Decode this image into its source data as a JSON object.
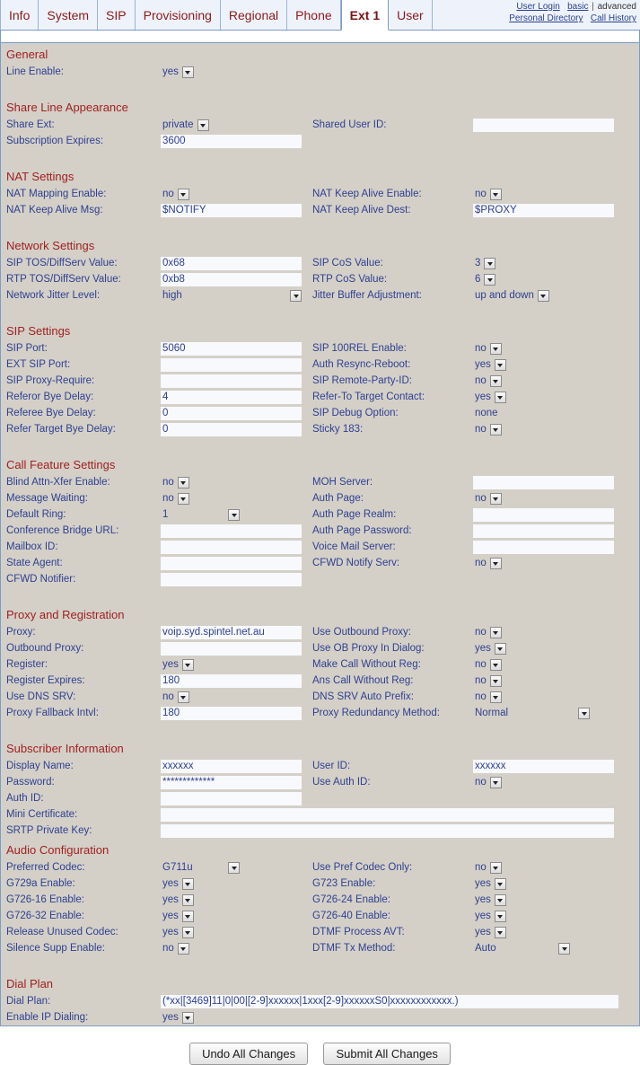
{
  "header": {
    "tabs": [
      {
        "label": "Info",
        "active": false
      },
      {
        "label": "System",
        "active": false
      },
      {
        "label": "SIP",
        "active": false
      },
      {
        "label": "Provisioning",
        "active": false
      },
      {
        "label": "Regional",
        "active": false
      },
      {
        "label": "Phone",
        "active": false
      },
      {
        "label": "Ext 1",
        "active": true
      },
      {
        "label": "User",
        "active": false
      }
    ],
    "links": {
      "user_login": "User Login",
      "basic": "basic",
      "separator": "|",
      "advanced": "advanced",
      "personal_directory": "Personal Directory",
      "call_history": "Call History"
    }
  },
  "sections": {
    "general": {
      "title": "General",
      "line_enable": {
        "label": "Line Enable:",
        "value": "yes"
      }
    },
    "share_line_appearance": {
      "title": "Share Line Appearance",
      "share_ext": {
        "label": "Share Ext:",
        "value": "private"
      },
      "shared_user_id": {
        "label": "Shared User ID:",
        "value": ""
      },
      "subscription_expires": {
        "label": "Subscription Expires:",
        "value": "3600"
      }
    },
    "nat_settings": {
      "title": "NAT Settings",
      "nat_mapping_enable": {
        "label": "NAT Mapping Enable:",
        "value": "no"
      },
      "nat_keep_alive_enable": {
        "label": "NAT Keep Alive Enable:",
        "value": "no"
      },
      "nat_keep_alive_msg": {
        "label": "NAT Keep Alive Msg:",
        "value": "$NOTIFY"
      },
      "nat_keep_alive_dest": {
        "label": "NAT Keep Alive Dest:",
        "value": "$PROXY"
      }
    },
    "network_settings": {
      "title": "Network Settings",
      "sip_tos": {
        "label": "SIP TOS/DiffServ Value:",
        "value": "0x68"
      },
      "sip_cos": {
        "label": "SIP CoS Value:",
        "value": "3"
      },
      "rtp_tos": {
        "label": "RTP TOS/DiffServ Value:",
        "value": "0xb8"
      },
      "rtp_cos": {
        "label": "RTP CoS Value:",
        "value": "6"
      },
      "network_jitter_level": {
        "label": "Network Jitter Level:",
        "value": "high"
      },
      "jitter_buffer_adjustment": {
        "label": "Jitter Buffer Adjustment:",
        "value": "up and down"
      }
    },
    "sip_settings": {
      "title": "SIP Settings",
      "sip_port": {
        "label": "SIP Port:",
        "value": "5060"
      },
      "sip_100rel_enable": {
        "label": "SIP 100REL Enable:",
        "value": "no"
      },
      "ext_sip_port": {
        "label": "EXT SIP Port:",
        "value": ""
      },
      "auth_resync_reboot": {
        "label": "Auth Resync-Reboot:",
        "value": "yes"
      },
      "sip_proxy_require": {
        "label": "SIP Proxy-Require:",
        "value": ""
      },
      "sip_remote_party_id": {
        "label": "SIP Remote-Party-ID:",
        "value": "no"
      },
      "referor_bye_delay": {
        "label": "Referor Bye Delay:",
        "value": "4"
      },
      "refer_to_target_contact": {
        "label": "Refer-To Target Contact:",
        "value": "yes"
      },
      "referee_bye_delay": {
        "label": "Referee Bye Delay:",
        "value": "0"
      },
      "sip_debug_option": {
        "label": "SIP Debug Option:",
        "value": "none"
      },
      "refer_target_bye_delay": {
        "label": "Refer Target Bye Delay:",
        "value": "0"
      },
      "sticky_183": {
        "label": "Sticky 183:",
        "value": "no"
      }
    },
    "call_feature_settings": {
      "title": "Call Feature Settings",
      "blind_attn_xfer_enable": {
        "label": "Blind Attn-Xfer Enable:",
        "value": "no"
      },
      "moh_server": {
        "label": "MOH Server:",
        "value": ""
      },
      "message_waiting": {
        "label": "Message Waiting:",
        "value": "no"
      },
      "auth_page": {
        "label": "Auth Page:",
        "value": "no"
      },
      "default_ring": {
        "label": "Default Ring:",
        "value": "1"
      },
      "auth_page_realm": {
        "label": "Auth Page Realm:",
        "value": ""
      },
      "conference_bridge_url": {
        "label": "Conference Bridge URL:",
        "value": ""
      },
      "auth_page_password": {
        "label": "Auth Page Password:",
        "value": ""
      },
      "mailbox_id": {
        "label": "Mailbox ID:",
        "value": ""
      },
      "voice_mail_server": {
        "label": "Voice Mail Server:",
        "value": ""
      },
      "state_agent": {
        "label": "State Agent:",
        "value": ""
      },
      "cfwd_notify_serv": {
        "label": "CFWD Notify Serv:",
        "value": "no"
      },
      "cfwd_notifier": {
        "label": "CFWD Notifier:",
        "value": ""
      }
    },
    "proxy_and_registration": {
      "title": "Proxy and Registration",
      "proxy": {
        "label": "Proxy:",
        "value": "voip.syd.spintel.net.au"
      },
      "use_outbound_proxy": {
        "label": "Use Outbound Proxy:",
        "value": "no"
      },
      "outbound_proxy": {
        "label": "Outbound Proxy:",
        "value": ""
      },
      "use_ob_proxy_in_dialog": {
        "label": "Use OB Proxy In Dialog:",
        "value": "yes"
      },
      "register": {
        "label": "Register:",
        "value": "yes"
      },
      "make_call_without_reg": {
        "label": "Make Call Without Reg:",
        "value": "no"
      },
      "register_expires": {
        "label": "Register Expires:",
        "value": "180"
      },
      "ans_call_without_reg": {
        "label": "Ans Call Without Reg:",
        "value": "no"
      },
      "use_dns_srv": {
        "label": "Use DNS SRV:",
        "value": "no"
      },
      "dns_srv_auto_prefix": {
        "label": "DNS SRV Auto Prefix:",
        "value": "no"
      },
      "proxy_fallback_intvl": {
        "label": "Proxy Fallback Intvl:",
        "value": "180"
      },
      "proxy_redundancy_method": {
        "label": "Proxy Redundancy Method:",
        "value": "Normal"
      }
    },
    "subscriber_information": {
      "title": "Subscriber Information",
      "display_name": {
        "label": "Display Name:",
        "value": "xxxxxx"
      },
      "user_id": {
        "label": "User ID:",
        "value": "xxxxxx"
      },
      "password": {
        "label": "Password:",
        "value": "*************"
      },
      "use_auth_id": {
        "label": "Use Auth ID:",
        "value": "no"
      },
      "auth_id": {
        "label": "Auth ID:",
        "value": ""
      },
      "mini_certificate": {
        "label": "Mini Certificate:",
        "value": ""
      },
      "srtp_private_key": {
        "label": "SRTP Private Key:",
        "value": ""
      }
    },
    "audio_configuration": {
      "title": "Audio Configuration",
      "preferred_codec": {
        "label": "Preferred Codec:",
        "value": "G711u"
      },
      "use_pref_codec_only": {
        "label": "Use Pref Codec Only:",
        "value": "no"
      },
      "g729a_enable": {
        "label": "G729a Enable:",
        "value": "yes"
      },
      "g723_enable": {
        "label": "G723 Enable:",
        "value": "yes"
      },
      "g726_16_enable": {
        "label": "G726-16 Enable:",
        "value": "yes"
      },
      "g726_24_enable": {
        "label": "G726-24 Enable:",
        "value": "yes"
      },
      "g726_32_enable": {
        "label": "G726-32 Enable:",
        "value": "yes"
      },
      "g726_40_enable": {
        "label": "G726-40 Enable:",
        "value": "yes"
      },
      "release_unused_codec": {
        "label": "Release Unused Codec:",
        "value": "yes"
      },
      "dtmf_process_avt": {
        "label": "DTMF Process AVT:",
        "value": "yes"
      },
      "silence_supp_enable": {
        "label": "Silence Supp Enable:",
        "value": "no"
      },
      "dtmf_tx_method": {
        "label": "DTMF Tx Method:",
        "value": "Auto"
      }
    },
    "dial_plan": {
      "title": "Dial Plan",
      "dial_plan": {
        "label": "Dial Plan:",
        "value": "(*xx|[3469]11|0|00|[2-9]xxxxxx|1xxx[2-9]xxxxxxS0|xxxxxxxxxxxx.)"
      },
      "enable_ip_dialing": {
        "label": "Enable IP Dialing:",
        "value": "yes"
      }
    }
  },
  "footer": {
    "undo_button": "Undo All Changes",
    "submit_button": "Submit All Changes"
  }
}
